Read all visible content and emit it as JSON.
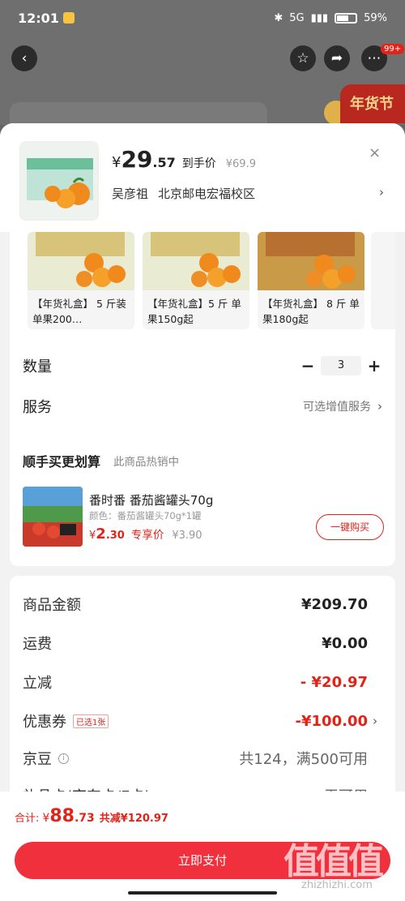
{
  "status": {
    "time": "12:01",
    "network": "5G",
    "battery": "59%"
  },
  "top": {
    "cart_badge": "99+",
    "festive": "年货节"
  },
  "header": {
    "currency": "¥",
    "price_int": "29",
    "price_dec": ".57",
    "price_tag": "到手价",
    "orig_price": "¥69.9",
    "close": "×",
    "address_name": "吴彦祖",
    "address": "北京邮电宏福校区",
    "chevron": "›"
  },
  "variants": [
    {
      "label": "【年货礼盒】 5 斤装 单果200…"
    },
    {
      "label": "【年货礼盒】5 斤 单果150g起"
    },
    {
      "label": "【年货礼盒】 8 斤 单果180g起"
    }
  ],
  "quantity": {
    "label": "数量",
    "minus": "−",
    "value": "3",
    "plus": "+"
  },
  "service": {
    "label": "服务",
    "value": "可选增值服务",
    "chevron": "›"
  },
  "upsell": {
    "title": "顺手买更划算",
    "subtitle": "此商品热销中",
    "item_name": "番时番 番茄酱罐头70g",
    "item_spec": "颜色：番茄酱罐头70g*1罐",
    "currency": "¥",
    "price_int": "2",
    "price_dec": ".30",
    "price_tag": "专享价",
    "orig_price": "¥3.90",
    "buy_label": "一键购买"
  },
  "summary": {
    "goods_label": "商品金额",
    "goods_value": "¥209.70",
    "shipping_label": "运费",
    "shipping_value": "¥0.00",
    "discount_label": "立减",
    "discount_value": "- ¥20.97",
    "coupon_label": "优惠券",
    "coupon_chosen": "已选1张",
    "coupon_value": "-¥100.00",
    "jd_bean_label": "京豆",
    "jd_bean_value": "共124，满500可用",
    "cut_label": "礼品卡(京东卡/E卡)",
    "cut_value": "无可用"
  },
  "bottom": {
    "total_label": "合计:",
    "currency": "¥",
    "total_int": "88",
    "total_dec": ".73",
    "saved": "共减¥120.97",
    "pay_label": "立即支付"
  },
  "watermark": {
    "logo": "值值值",
    "site": "zhizhizhi.com"
  },
  "colors": {
    "accent": "#e2231a",
    "pay_button": "#f0303c"
  }
}
